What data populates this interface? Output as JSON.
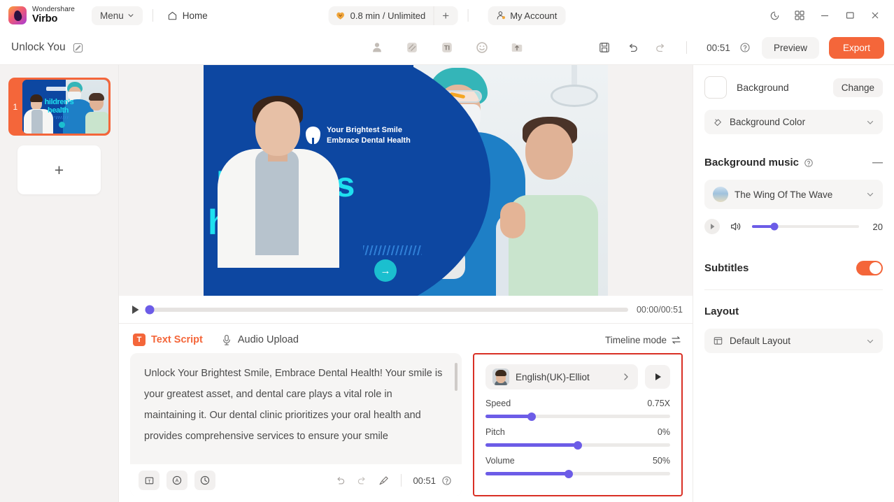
{
  "titlebar": {
    "brand_top": "Wondershare",
    "brand_bottom": "Virbo",
    "menu_label": "Menu",
    "home_label": "Home",
    "credits_label": "0.8 min / Unlimited",
    "credits_plus": "+",
    "account_label": "My Account",
    "icons": {
      "history": "history-icon",
      "apps": "grid-apps-icon",
      "minimize": "minimize-icon",
      "maximize": "maximize-icon",
      "close": "close-icon"
    }
  },
  "subbar": {
    "project_title": "Unlock You",
    "tools": [
      {
        "name": "avatar-tool",
        "label": "Avatar"
      },
      {
        "name": "background-tool",
        "label": "Background"
      },
      {
        "name": "text-tool",
        "label": "TI"
      },
      {
        "name": "sticker-tool",
        "label": "Sticker"
      },
      {
        "name": "upload-tool",
        "label": "Upload"
      }
    ],
    "duration": "00:51",
    "preview_label": "Preview",
    "export_label": "Export"
  },
  "scenes": {
    "items": [
      {
        "number": "1",
        "selected": true
      }
    ],
    "add_label": "+"
  },
  "canvas": {
    "logo_line1": "Your Brightest Smile",
    "logo_line2": "Embrace Dental Health",
    "title_line1": "hildren's",
    "title_line2": "health",
    "arrow": "→"
  },
  "player": {
    "current_and_total": "00:00/00:51",
    "progress_percent": 0
  },
  "script": {
    "tab_text_script": "Text Script",
    "tab_text_badge": "T",
    "tab_audio_upload": "Audio Upload",
    "timeline_mode": "Timeline mode",
    "content": "Unlock Your Brightest Smile, Embrace Dental Health!\nYour smile is your greatest asset, and dental care plays a vital role in maintaining it.\nOur dental clinic prioritizes your oral health and provides comprehensive services to ensure your smile",
    "footer": {
      "text_box_icon": "text-box-icon",
      "pronunciation_icon": "pronunciation-icon",
      "pause_icon": "pause-insert-icon",
      "undo_icon": "undo-icon",
      "redo_icon": "redo-icon",
      "clear_icon": "clear-broom-icon",
      "duration": "00:51"
    }
  },
  "voice": {
    "name": "English(UK)-Elliot",
    "sliders": [
      {
        "label": "Speed",
        "value": "0.75X",
        "percent": 25
      },
      {
        "label": "Pitch",
        "value": "0%",
        "percent": 50
      },
      {
        "label": "Volume",
        "value": "50%",
        "percent": 45
      }
    ]
  },
  "right_panel": {
    "background_label": "Background",
    "change_label": "Change",
    "background_color_label": "Background Color",
    "music_section_title": "Background music",
    "music_track": "The Wing Of The Wave",
    "music_volume": "20",
    "music_volume_percent": 21,
    "subtitles_label": "Subtitles",
    "subtitles_on": true,
    "layout_title": "Layout",
    "layout_value": "Default Layout"
  },
  "colors": {
    "accent_orange": "#f4663a",
    "slider_purple": "#6c5ce7",
    "highlight_border": "#d93025",
    "canvas_blue": "#0d47a1",
    "canvas_cyan": "#1fe0ef"
  }
}
